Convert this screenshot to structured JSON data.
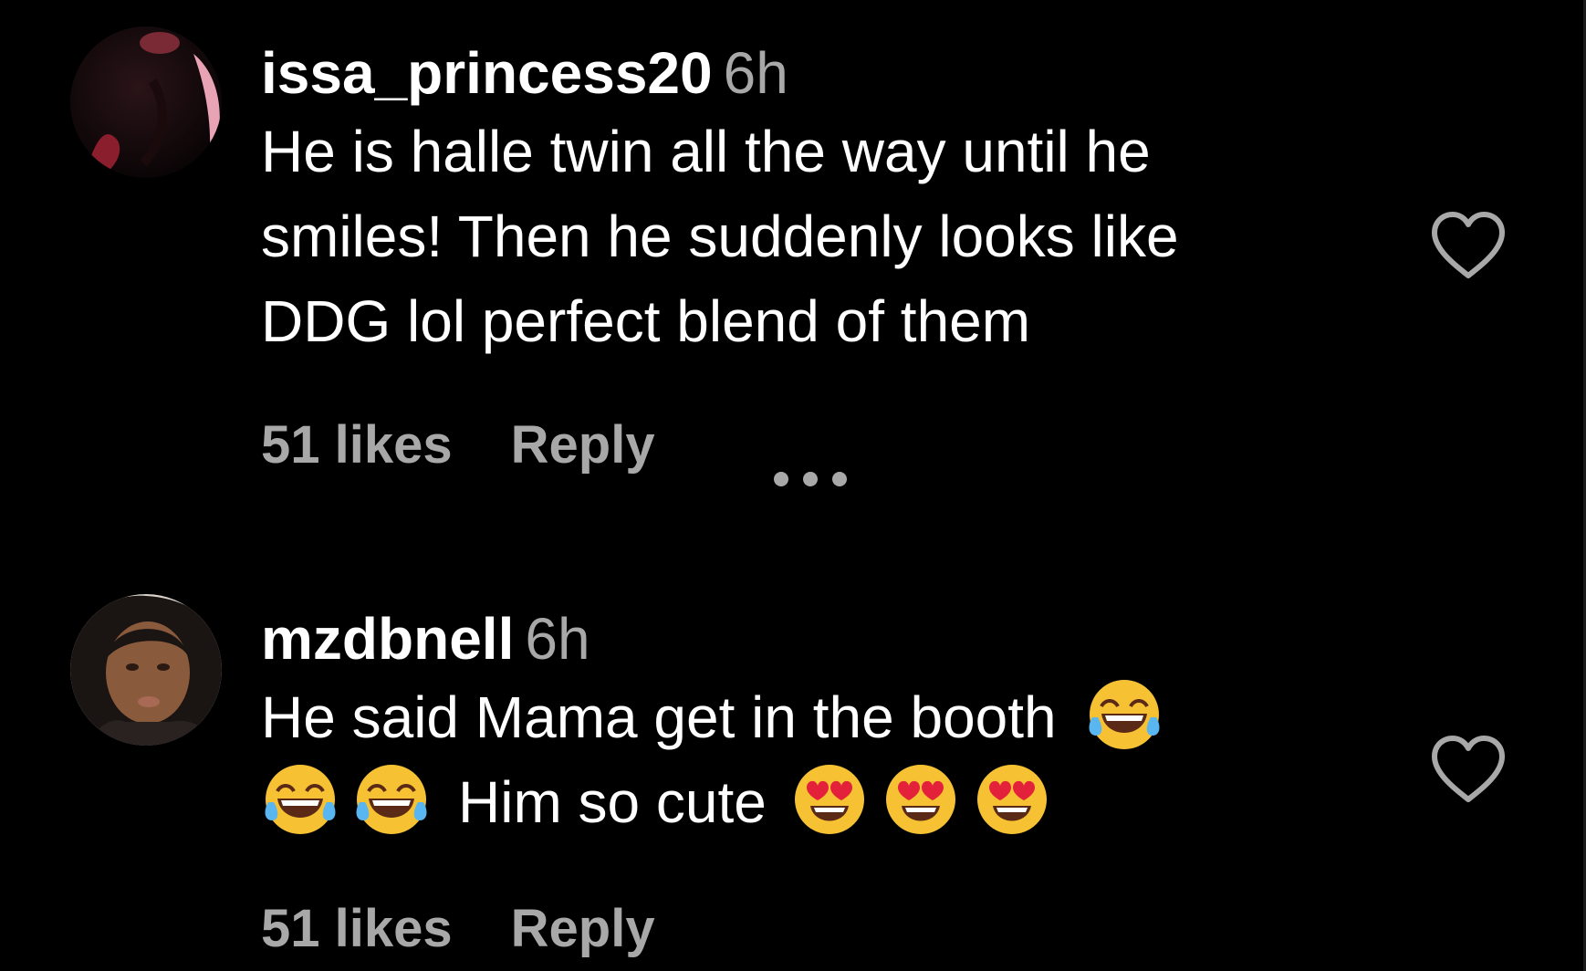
{
  "colors": {
    "background": "#000000",
    "primary_text": "#ffffff",
    "secondary_text": "#a8a8a8"
  },
  "comments": [
    {
      "username": "issa_princess20",
      "time": "6h",
      "lines": [
        "He is halle twin all the way until he",
        "smiles! Then he suddenly looks like",
        "DDG lol perfect blend of them"
      ],
      "likes": "51 likes",
      "reply_label": "Reply",
      "more_icon": "more-options-icon",
      "like_icon": "heart-icon"
    },
    {
      "username": "mzdbnell",
      "time": "6h",
      "line1_text": "He said Mama get in the booth",
      "line2_text": "Him so cute",
      "emojis_line1": [
        "😂"
      ],
      "emojis_line2_before": [
        "😂",
        "😂"
      ],
      "emojis_line2_after": [
        "😍",
        "😍",
        "😍"
      ],
      "likes": "51 likes",
      "reply_label": "Reply",
      "like_icon": "heart-icon"
    }
  ]
}
